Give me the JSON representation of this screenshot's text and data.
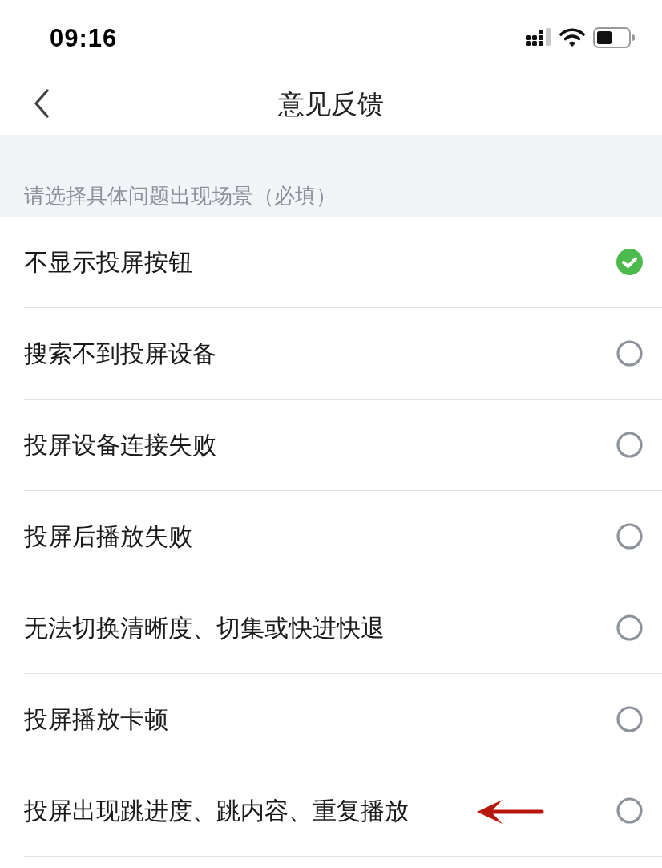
{
  "status_bar": {
    "time": "09:16"
  },
  "nav_bar": {
    "title": "意见反馈"
  },
  "section": {
    "label": "请选择具体问题出现场景（必填）"
  },
  "options": [
    {
      "label": "不显示投屏按钮",
      "selected": true,
      "marked": false
    },
    {
      "label": "搜索不到投屏设备",
      "selected": false,
      "marked": false
    },
    {
      "label": "投屏设备连接失败",
      "selected": false,
      "marked": false
    },
    {
      "label": "投屏后播放失败",
      "selected": false,
      "marked": false
    },
    {
      "label": "无法切换清晰度、切集或快进快退",
      "selected": false,
      "marked": false
    },
    {
      "label": "投屏播放卡顿",
      "selected": false,
      "marked": false
    },
    {
      "label": "投屏出现跳进度、跳内容、重复播放",
      "selected": false,
      "marked": true
    }
  ]
}
